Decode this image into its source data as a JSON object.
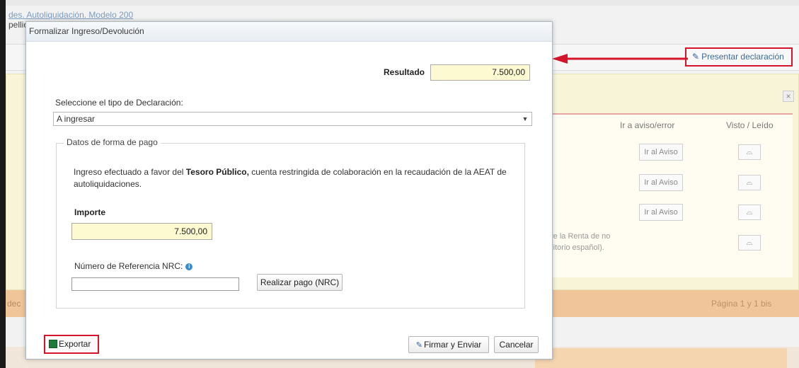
{
  "background": {
    "breadcrumb_line1": "des. Autoliquidación. Modelo 200",
    "breadcrumb_line2": "pellic",
    "present_button_label": "Presentar declaración",
    "close_label": "×",
    "table_headers": [
      "Ir a aviso/error",
      "Visto / Leído"
    ],
    "row_button_label": "Ir al Aviso",
    "note_line1": "re la Renta de no",
    "note_line2": "ritorio español).",
    "footer_left": "dec",
    "footer_pagination": "Página 1 y 1 bis",
    "accent_red": "#d3142a"
  },
  "modal": {
    "title": "Formalizar Ingreso/Devolución",
    "resultado_label": "Resultado",
    "resultado_value": "7.500,00",
    "select_label": "Seleccione el tipo de Declaración:",
    "select_value": "A ingresar",
    "fieldset_legend": "Datos de forma de pago",
    "info_prefix": "Ingreso efectuado a favor del",
    "info_bold": "Tesoro Público,",
    "info_suffix": "cuenta restringida de colaboración en la recaudación de la AEAT de autoliquidaciones.",
    "importe_label": "Importe",
    "importe_value": "7.500,00",
    "nrc_label": "Número de Referencia NRC:",
    "nrc_value": "",
    "realizar_pago_label": "Realizar pago (NRC)",
    "exportar_label": "Exportar",
    "firmar_label": "Firmar y Enviar",
    "cancelar_label": "Cancelar"
  }
}
